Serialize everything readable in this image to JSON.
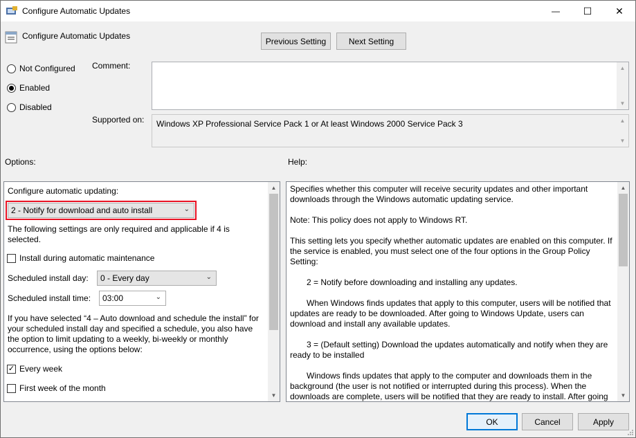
{
  "window": {
    "title": "Configure Automatic Updates",
    "minimize": "—",
    "maximize": "☐",
    "close": "✕"
  },
  "header": {
    "title": "Configure Automatic Updates",
    "prev_btn": "Previous Setting",
    "next_btn": "Next Setting"
  },
  "state": {
    "not_configured": "Not Configured",
    "enabled": "Enabled",
    "disabled": "Disabled",
    "selected": "Enabled"
  },
  "comment": {
    "label": "Comment:",
    "value": ""
  },
  "supported": {
    "label": "Supported on:",
    "value": "Windows XP Professional Service Pack 1 or At least Windows 2000 Service Pack 3"
  },
  "options": {
    "label": "Options:",
    "configure_label": "Configure automatic updating:",
    "configure_value": "2 - Notify for download and auto install",
    "note": "The following settings are only required and applicable if 4 is selected.",
    "install_maintenance": "Install during automatic maintenance",
    "install_maintenance_checked": false,
    "day_label": "Scheduled install day:",
    "day_value": "0 - Every day",
    "time_label": "Scheduled install time:",
    "time_value": "03:00",
    "weekly_note": "If you have selected “4 – Auto download and schedule the install” for your scheduled install day and specified a schedule, you also have the option to limit updating to a weekly, bi-weekly or monthly occurrence, using the options below:",
    "every_week": "Every week",
    "every_week_checked": true,
    "first_week": "First week of the month",
    "first_week_checked": false
  },
  "help": {
    "label": "Help:",
    "paragraphs": [
      "Specifies whether this computer will receive security updates and other important downloads through the Windows automatic updating service.",
      "Note: This policy does not apply to Windows RT.",
      "This setting lets you specify whether automatic updates are enabled on this computer. If the service is enabled, you must select one of the four options in the Group Policy Setting:",
      "2 = Notify before downloading and installing any updates.",
      "When Windows finds updates that apply to this computer, users will be notified that updates are ready to be downloaded. After going to Windows Update, users can download and install any available updates.",
      "3 = (Default setting) Download the updates automatically and notify when they are ready to be installed",
      "Windows finds updates that apply to the computer and downloads them in the background (the user is not notified or interrupted during this process). When the downloads are complete, users will be notified that they are ready to install. After going to Windows Update, users can install them."
    ]
  },
  "footer": {
    "ok": "OK",
    "cancel": "Cancel",
    "apply": "Apply"
  },
  "colors": {
    "accent": "#0078d7",
    "highlight": "#e81123"
  }
}
